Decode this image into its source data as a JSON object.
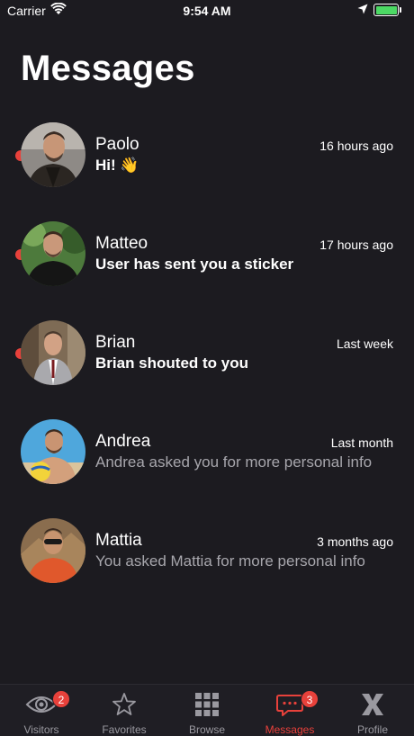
{
  "status_bar": {
    "carrier": "Carrier",
    "time": "9:54 AM"
  },
  "page_title": "Messages",
  "messages": [
    {
      "name": "Paolo",
      "time": "16 hours ago",
      "preview": "Hi! 👋",
      "unread": true
    },
    {
      "name": "Matteo",
      "time": "17 hours ago",
      "preview": "User has sent you a sticker",
      "unread": true
    },
    {
      "name": "Brian",
      "time": "Last week",
      "preview": "Brian shouted to you",
      "unread": true
    },
    {
      "name": "Andrea",
      "time": "Last month",
      "preview": "Andrea asked you for more personal info",
      "unread": false
    },
    {
      "name": "Mattia",
      "time": "3 months ago",
      "preview": "You asked Mattia for more personal info",
      "unread": false
    }
  ],
  "tabs": [
    {
      "label": "Visitors",
      "badge": "2",
      "icon": "eye-icon"
    },
    {
      "label": "Favorites",
      "badge": "",
      "icon": "star-icon"
    },
    {
      "label": "Browse",
      "badge": "",
      "icon": "grid-icon"
    },
    {
      "label": "Messages",
      "badge": "3",
      "icon": "chat-icon",
      "active": true
    },
    {
      "label": "Profile",
      "badge": "",
      "icon": "x-logo-icon"
    }
  ],
  "colors": {
    "background": "#1c1b20",
    "accent": "#e8413b",
    "muted_text": "#a7a6ac",
    "battery": "#4cd964"
  }
}
